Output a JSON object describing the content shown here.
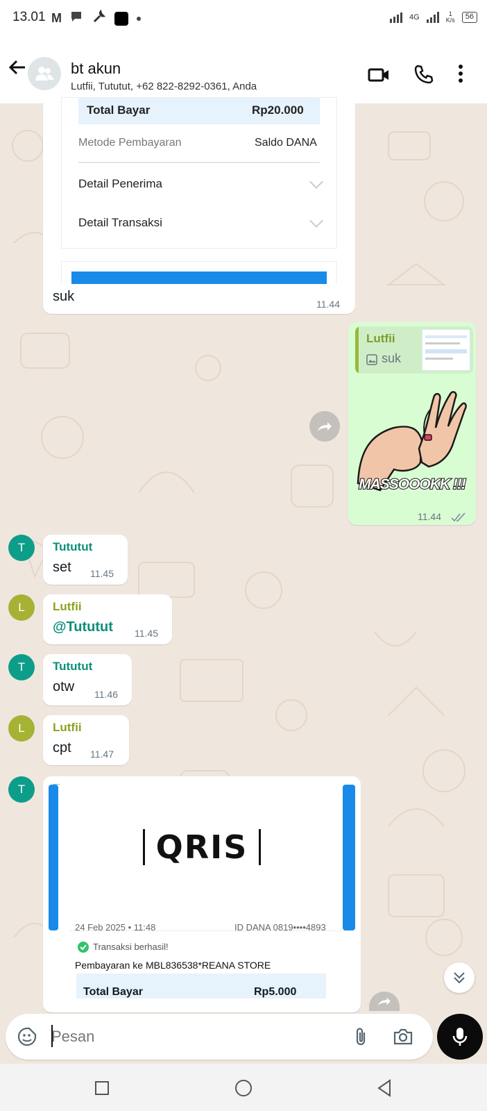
{
  "status_bar": {
    "time": "13.01",
    "network": "4G",
    "speed_value": "1",
    "speed_unit": "K/s",
    "battery": "56"
  },
  "header": {
    "title": "bt akun",
    "subtitle": "Lutfii, Tututut, +62 822-8292-0361, Anda"
  },
  "receipt_top": {
    "total_label": "Total Bayar",
    "total_value": "Rp20.000",
    "method_label": "Metode Pembayaran",
    "method_value": "Saldo DANA",
    "recipient_label": "Detail Penerima",
    "transaction_label": "Detail Transaksi",
    "caption": "suk",
    "time": "11.44"
  },
  "outgoing_sticker": {
    "quote_sender": "Lutfii",
    "quote_text": "suk",
    "sticker_text": "MASSOOOKK !!!",
    "time": "11.44"
  },
  "messages": [
    {
      "sender": "Tututut",
      "initial": "T",
      "text": "set",
      "time": "11.45",
      "color": "#0b8f7a",
      "avatar_color": "#0d9e8a"
    },
    {
      "sender": "Lutfii",
      "initial": "L",
      "text": "@Tututut",
      "time": "11.45",
      "color": "#8ba220",
      "avatar_color": "#a6b234"
    },
    {
      "sender": "Tututut",
      "initial": "T",
      "text": "otw",
      "time": "11.46",
      "color": "#0b8f7a",
      "avatar_color": "#0d9e8a"
    },
    {
      "sender": "Lutfii",
      "initial": "L",
      "text": "cpt",
      "time": "11.47",
      "color": "#8ba220",
      "avatar_color": "#a6b234"
    }
  ],
  "qris_message": {
    "sender": "Tututut",
    "initial": "T",
    "logo_text": "QRIS",
    "date": "24 Feb 2025 • 11:48",
    "dana_id": "ID DANA 0819••••4893",
    "status": "Transaksi berhasil!",
    "payee": "Pembayaran ke MBL836538*REANA STORE",
    "total_label": "Total Bayar",
    "total_value": "Rp5.000"
  },
  "composer": {
    "placeholder": "Pesan"
  },
  "colors": {
    "chat_bg": "#efe7de",
    "outgoing_bubble": "#d9fdd3",
    "dana_blue": "#1a8ae8"
  }
}
